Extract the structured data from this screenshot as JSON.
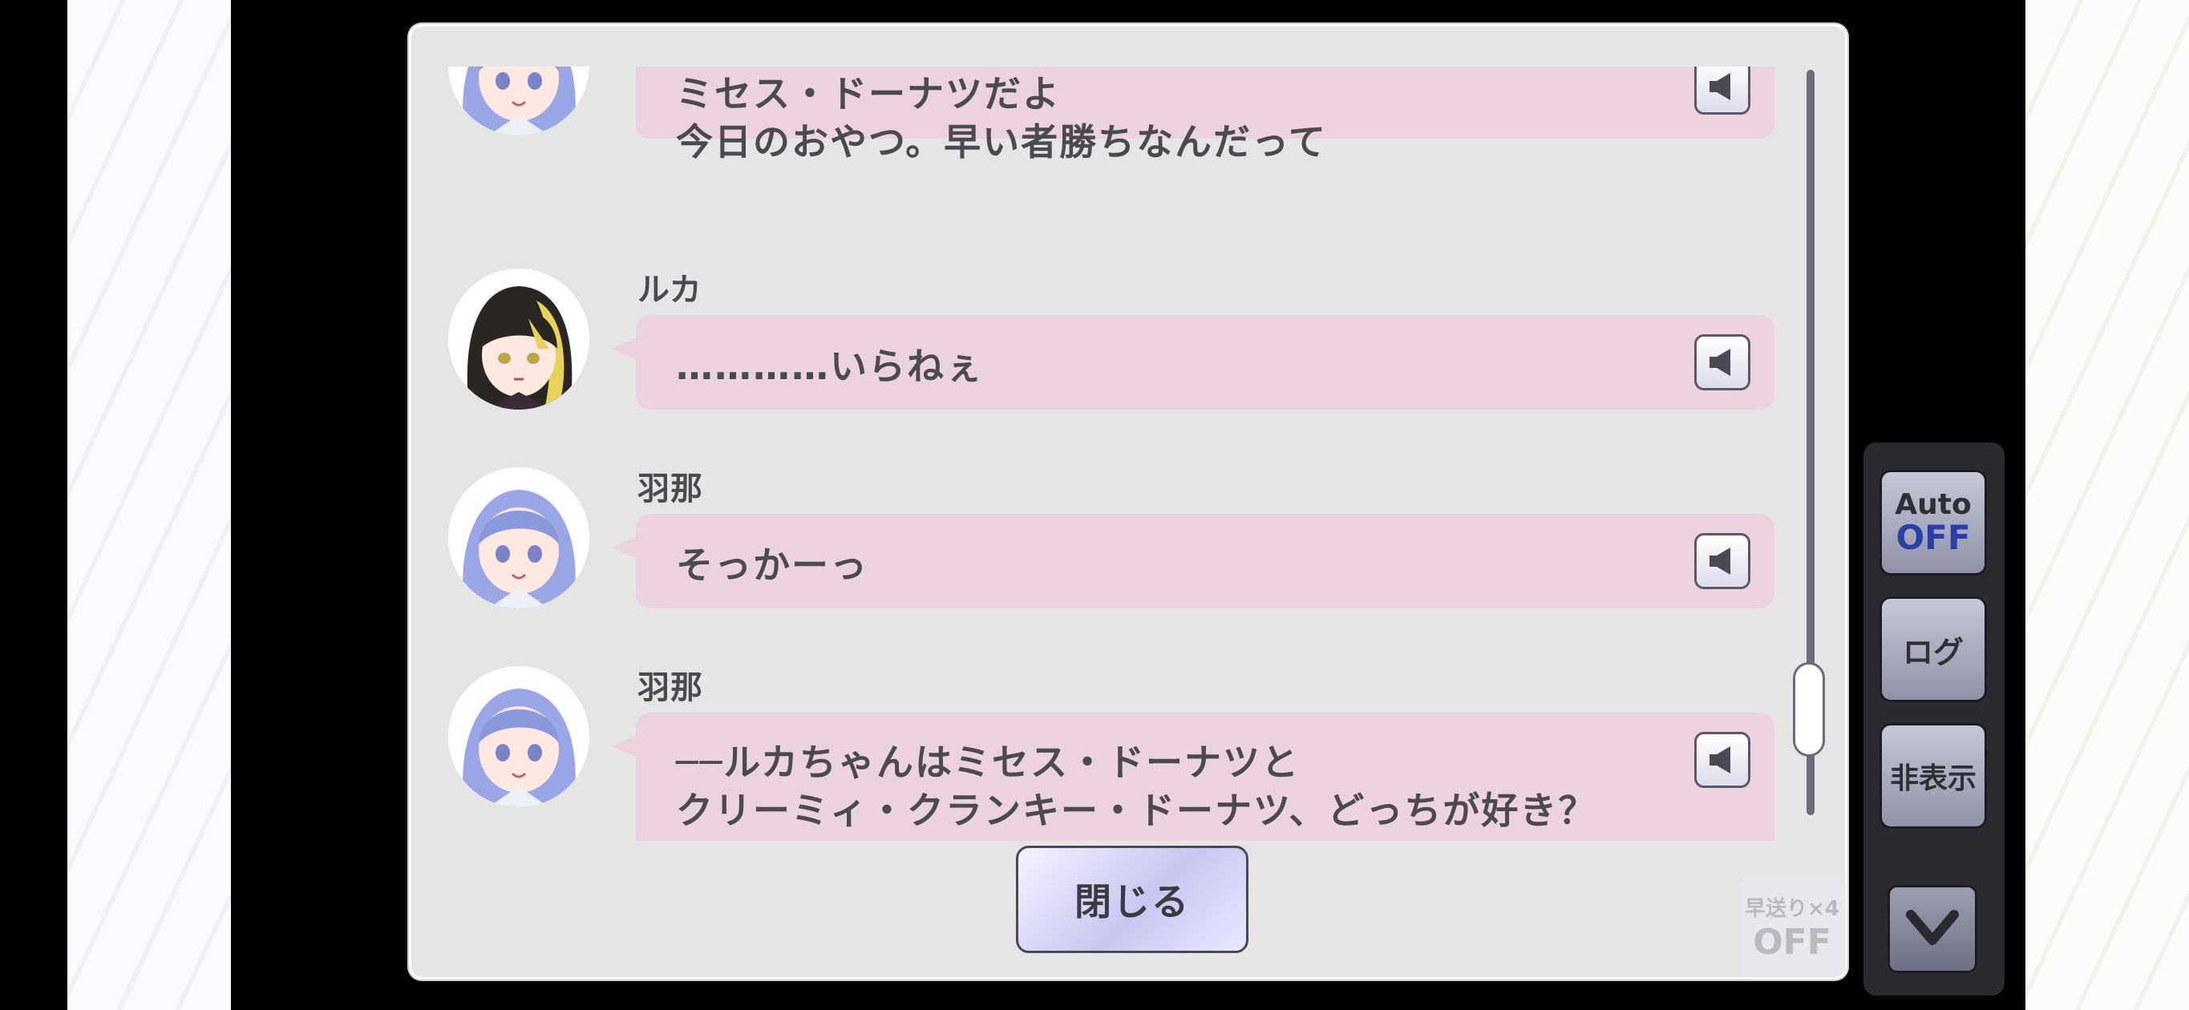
{
  "log": {
    "entries": [
      {
        "speaker": "",
        "avatar": "habana-portrait",
        "lines": [
          "ミセス・ドーナツだよ",
          "今日のおやつ。早い者勝ちなんだって"
        ],
        "voice_icon": "speaker-icon"
      },
      {
        "speaker": "ルカ",
        "avatar": "ruka-portrait",
        "lines": [
          "…………いらねぇ"
        ],
        "voice_icon": "speaker-icon"
      },
      {
        "speaker": "羽那",
        "avatar": "habana-portrait",
        "lines": [
          "そっかーっ"
        ],
        "voice_icon": "speaker-icon"
      },
      {
        "speaker": "羽那",
        "avatar": "habana-portrait",
        "lines": [
          "──ルカちゃんはミセス・ドーナツと",
          "クリーミィ・クランキー・ドーナツ、どっちが好き？"
        ],
        "voice_icon": "speaker-icon"
      }
    ],
    "close_label": "閉じる"
  },
  "side_menu": {
    "auto_label": "Auto",
    "auto_state": "OFF",
    "log_label": "ログ",
    "hide_label": "非表示",
    "collapse_icon": "chevron-down-icon",
    "speed_label": "早送り×4",
    "speed_state": "OFF"
  },
  "colors": {
    "bubble": "#ecd2de",
    "panel": "#e6e5e6",
    "accent_blue": "#2a3fa8",
    "text": "#4a4a50"
  }
}
